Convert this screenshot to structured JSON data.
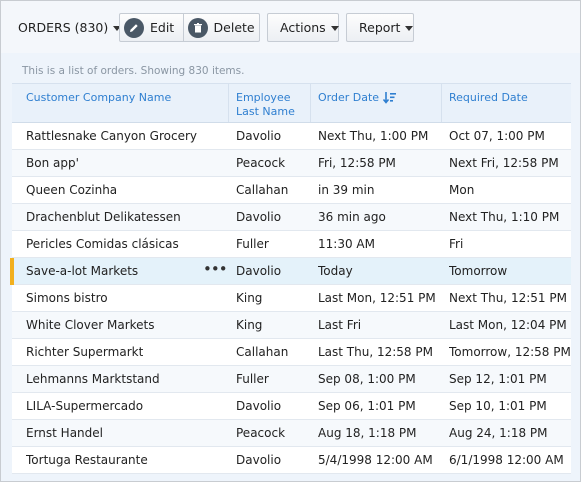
{
  "toolbar": {
    "title": "ORDERS (830)",
    "edit": "Edit",
    "delete": "Delete",
    "actions": "Actions",
    "report": "Report"
  },
  "info_text": "This is a list of orders. Showing 830 items.",
  "columns": [
    {
      "label": "Customer Company Name"
    },
    {
      "label": "Employee Last Name"
    },
    {
      "label": "Order Date"
    },
    {
      "label": "Required Date"
    }
  ],
  "rows": [
    {
      "company": "Rattlesnake Canyon Grocery",
      "employee": "Davolio",
      "order_date": "Next Thu, 1:00 PM",
      "required_date": "Oct 07, 1:00 PM"
    },
    {
      "company": "Bon app'",
      "employee": "Peacock",
      "order_date": "Fri, 12:58 PM",
      "required_date": "Next Fri, 12:58 PM"
    },
    {
      "company": "Queen Cozinha",
      "employee": "Callahan",
      "order_date": "in 39 min",
      "required_date": "Mon"
    },
    {
      "company": "Drachenblut Delikatessen",
      "employee": "Davolio",
      "order_date": "36 min ago",
      "required_date": "Next Thu, 1:10 PM"
    },
    {
      "company": "Pericles Comidas clásicas",
      "employee": "Fuller",
      "order_date": "11:30 AM",
      "required_date": "Fri"
    },
    {
      "company": "Save-a-lot Markets",
      "employee": "Davolio",
      "order_date": "Today",
      "required_date": "Tomorrow",
      "selected": true
    },
    {
      "company": "Simons bistro",
      "employee": "King",
      "order_date": "Last Mon, 12:51 PM",
      "required_date": "Next Thu, 12:51 PM"
    },
    {
      "company": "White Clover Markets",
      "employee": "King",
      "order_date": "Last Fri",
      "required_date": "Last Mon, 12:04 PM"
    },
    {
      "company": "Richter Supermarkt",
      "employee": "Callahan",
      "order_date": "Last Thu, 12:58 PM",
      "required_date": "Tomorrow, 12:58 PM"
    },
    {
      "company": "Lehmanns Marktstand",
      "employee": "Fuller",
      "order_date": "Sep 08, 1:00 PM",
      "required_date": "Sep 12, 1:01 PM"
    },
    {
      "company": "LILA-Supermercado",
      "employee": "Davolio",
      "order_date": "Sep 06, 1:01 PM",
      "required_date": "Sep 10, 1:01 PM"
    },
    {
      "company": "Ernst Handel",
      "employee": "Peacock",
      "order_date": "Aug 18, 1:18 PM",
      "required_date": "Aug 24, 1:18 PM"
    },
    {
      "company": "Tortuga Restaurante",
      "employee": "Davolio",
      "order_date": "5/4/1998 12:00 AM",
      "required_date": "6/1/1998 12:00 AM"
    }
  ],
  "row_menu_glyph": "•••",
  "icons": {
    "edit": "pencil-icon",
    "delete": "trash-icon",
    "sort": "sort-descending-icon"
  },
  "colors": {
    "link": "#2f7fd0",
    "selection_marker": "#f2b01e"
  }
}
